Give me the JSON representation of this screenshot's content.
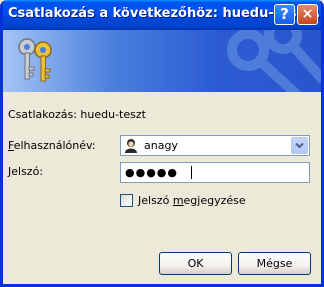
{
  "window": {
    "title": "Csatlakozás a következőhöz: huedu-teszt..."
  },
  "titlebar_buttons": {
    "help_icon": "question-mark",
    "help_label": "?",
    "close_icon": "x",
    "close_label": "×"
  },
  "banner": {
    "icon": "keys-icon"
  },
  "connect_line": "Csatlakozás: huedu-teszt",
  "username": {
    "label_prefix": "",
    "label_accesskey": "F",
    "label_rest": "elhasználónév:",
    "value": "anagy",
    "icon": "user-avatar-icon"
  },
  "password": {
    "label_prefix": "",
    "label_accesskey": "J",
    "label_rest": "elszó:",
    "value": "●●●●●"
  },
  "remember": {
    "label_prefix": "Jelszó ",
    "label_accesskey": "m",
    "label_rest": "egjegyzése",
    "checked": false
  },
  "buttons": {
    "ok": "OK",
    "cancel": "Mégse"
  },
  "colors": {
    "title_blue": "#0054e3",
    "dialog_bg": "#ece9d8",
    "input_border": "#7f9db9",
    "button_border": "#003c74"
  }
}
